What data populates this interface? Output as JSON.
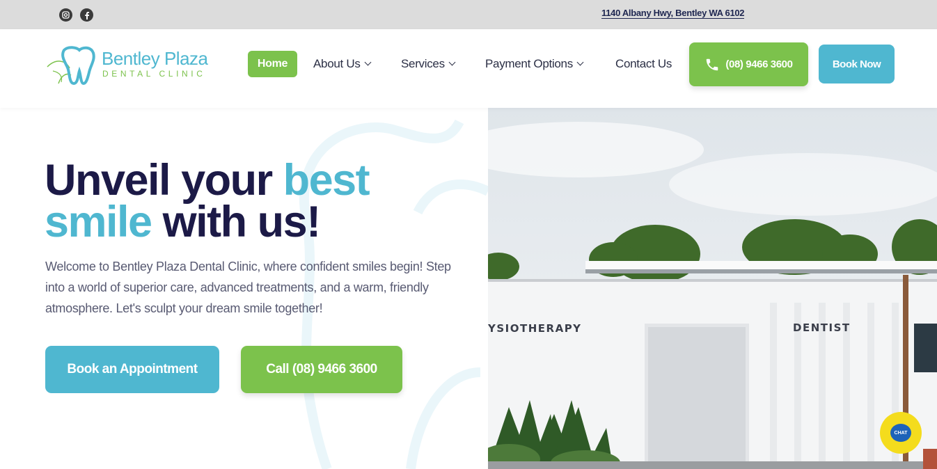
{
  "topbar": {
    "social": [
      "instagram-icon",
      "facebook-icon"
    ],
    "address": "1140 Albany Hwy, Bentley WA 6102"
  },
  "header": {
    "logo_name": "Bentley Plaza",
    "logo_sub": "DENTAL CLINIC",
    "nav": {
      "home": "Home",
      "about": "About Us",
      "services": "Services",
      "payment": "Payment Options",
      "contact": "Contact Us"
    },
    "phone_label": "(08) 9466 3600",
    "book_label": "Book Now"
  },
  "hero": {
    "headline_1": "Unveil your ",
    "headline_1_highlight": "best",
    "headline_2_highlight": "smile",
    "headline_2": " with us!",
    "intro": "Welcome to Bentley Plaza Dental Clinic, where confident smiles begin! Step into a world of superior care, advanced treatments, and a warm, friendly atmosphere. Let's sculpt your dream smile together!",
    "appointment_label": "Book an Appointment",
    "call_label": "Call (08) 9466 3600"
  },
  "photo": {
    "sign_left": "YSIOTHERAPY",
    "sign_right": "DENTIST"
  },
  "chat": {
    "label": "CHAT"
  },
  "colors": {
    "brand_blue": "#4fb7d0",
    "brand_green": "#7cc24c",
    "navy": "#1c1a47",
    "topbar": "#dcdcdc",
    "chat_yellow": "#f4dc1d"
  }
}
